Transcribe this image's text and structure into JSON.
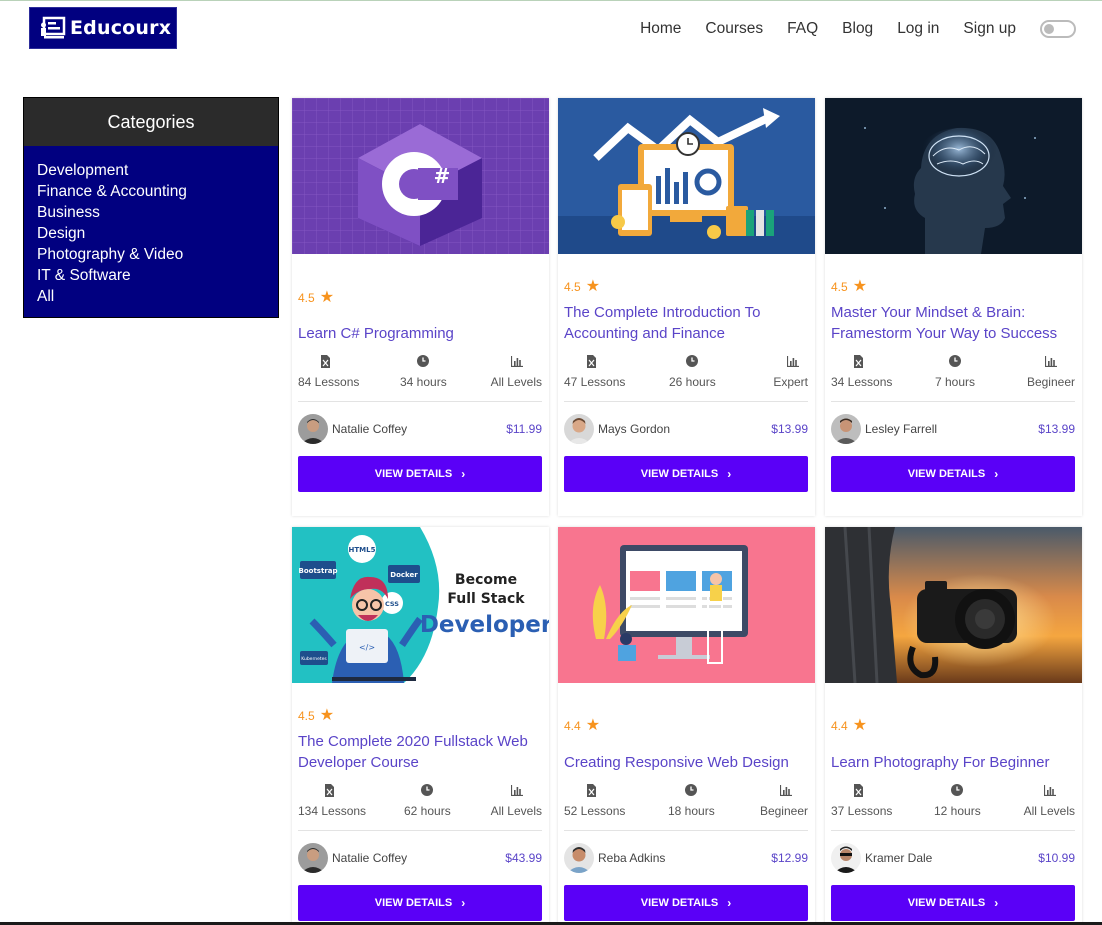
{
  "brand": {
    "name": "Educourx",
    "bg_color": "#010080"
  },
  "nav": {
    "items": [
      "Home",
      "Courses",
      "FAQ",
      "Blog",
      "Log in",
      "Sign up"
    ],
    "theme_toggle": "off"
  },
  "sidebar": {
    "title": "Categories",
    "items": [
      "Development",
      "Finance & Accounting",
      "Business",
      "Design",
      "Photography & Video",
      "IT & Software",
      "All"
    ]
  },
  "colors": {
    "accent": "#5a00f7",
    "title": "#5a44c8",
    "rating": "#f7931e"
  },
  "courses": [
    {
      "thumb": "csharp-logo",
      "rating": "4.5",
      "title": "Learn C# Programming",
      "lessons": "84 Lessons",
      "hours": "34 hours",
      "level": "All Levels",
      "author": "Natalie Coffey",
      "price": "$11.99",
      "button": "VIEW DETAILS"
    },
    {
      "thumb": "accounting-finance",
      "rating": "4.5",
      "title": "The Complete Introduction To Accounting and Finance",
      "lessons": "47 Lessons",
      "hours": "26 hours",
      "level": "Expert",
      "author": "Mays Gordon",
      "price": "$13.99",
      "button": "VIEW DETAILS"
    },
    {
      "thumb": "brain-head",
      "rating": "4.5",
      "title": "Master Your Mindset & Brain: Framestorm Your Way to Success",
      "lessons": "34 Lessons",
      "hours": "7 hours",
      "level": "Begineer",
      "author": "Lesley Farrell",
      "price": "$13.99",
      "button": "VIEW DETAILS"
    },
    {
      "thumb": "fullstack-developer",
      "thumb_text": [
        "Become",
        "Full Stack",
        "Developer"
      ],
      "thumb_badges": [
        "HTML5",
        "Bootstrap",
        "Docker",
        "CSS",
        "Kubernetes",
        "</>"
      ],
      "rating": "4.5",
      "title": "The Complete 2020 Fullstack Web Developer Course",
      "lessons": "134 Lessons",
      "hours": "62 hours",
      "level": "All Levels",
      "author": "Natalie Coffey",
      "price": "$43.99",
      "button": "VIEW DETAILS"
    },
    {
      "thumb": "responsive-design",
      "rating": "4.4",
      "title": "Creating Responsive Web Design",
      "lessons": "52 Lessons",
      "hours": "18 hours",
      "level": "Begineer",
      "author": "Reba Adkins",
      "price": "$12.99",
      "button": "VIEW DETAILS"
    },
    {
      "thumb": "camera-sunset",
      "rating": "4.4",
      "title": "Learn Photography For Beginner",
      "lessons": "37 Lessons",
      "hours": "12 hours",
      "level": "All Levels",
      "author": "Kramer Dale",
      "price": "$10.99",
      "button": "VIEW DETAILS"
    }
  ]
}
